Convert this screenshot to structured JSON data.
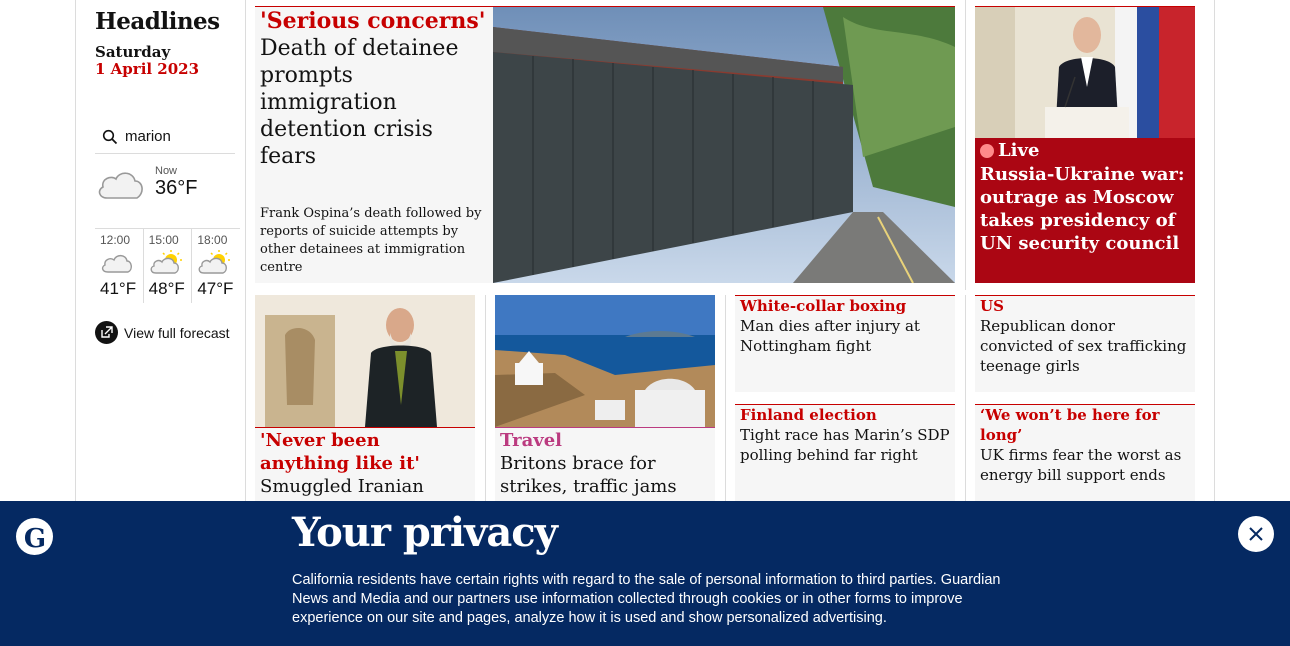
{
  "sidebar": {
    "title": "Headlines",
    "day": "Saturday",
    "date": "1 April 2023",
    "search_value": "marion",
    "weather": {
      "now_label": "Now",
      "now_temp": "36°F",
      "now_icon": "cloud-icon",
      "forecast": [
        {
          "time": "12:00",
          "temp": "41°F",
          "icon": "cloud-icon"
        },
        {
          "time": "15:00",
          "temp": "48°F",
          "icon": "sun-cloud-icon"
        },
        {
          "time": "18:00",
          "temp": "47°F",
          "icon": "sun-cloud-icon"
        }
      ],
      "full_forecast_label": "View full forecast"
    }
  },
  "main_story": {
    "kicker": "'Serious concerns'",
    "headline": "Death of detainee prompts immigration detention crisis fears",
    "standfirst": "Frank Ospina’s death followed by reports of suicide attempts by other detainees at immigration centre"
  },
  "live_story": {
    "live_label": "Live",
    "headline": "Russia-Ukraine war: outrage as Moscow takes presidency of UN security council"
  },
  "card_iran": {
    "kicker": "'Never been anything like it'",
    "headline": "Smuggled Iranian"
  },
  "card_travel": {
    "kicker": "Travel",
    "headline": "Britons brace for strikes, traffic jams and"
  },
  "small_cards": [
    {
      "kicker": "White-collar boxing",
      "headline": "Man dies after injury at Nottingham fight"
    },
    {
      "kicker": "US",
      "headline": "Republican donor convicted of sex trafficking teenage girls"
    },
    {
      "kicker": "Finland election",
      "headline": "Tight race has Marin’s SDP polling behind far right"
    },
    {
      "kicker": "‘We won’t be here for long’",
      "headline": "UK firms fear the worst as energy bill support ends"
    }
  ],
  "privacy": {
    "title": "Your privacy",
    "body": "California residents have certain rights with regard to the sale of personal information to third parties. Guardian News and Media and our partners use information collected through cookies or in other forms to improve experience on our site and pages, analyze how it is used and show personalized advertising."
  },
  "colors": {
    "news_red": "#c70000",
    "live_red": "#ab0613",
    "travel_pink": "#bb3b80",
    "privacy_blue": "#052962"
  }
}
